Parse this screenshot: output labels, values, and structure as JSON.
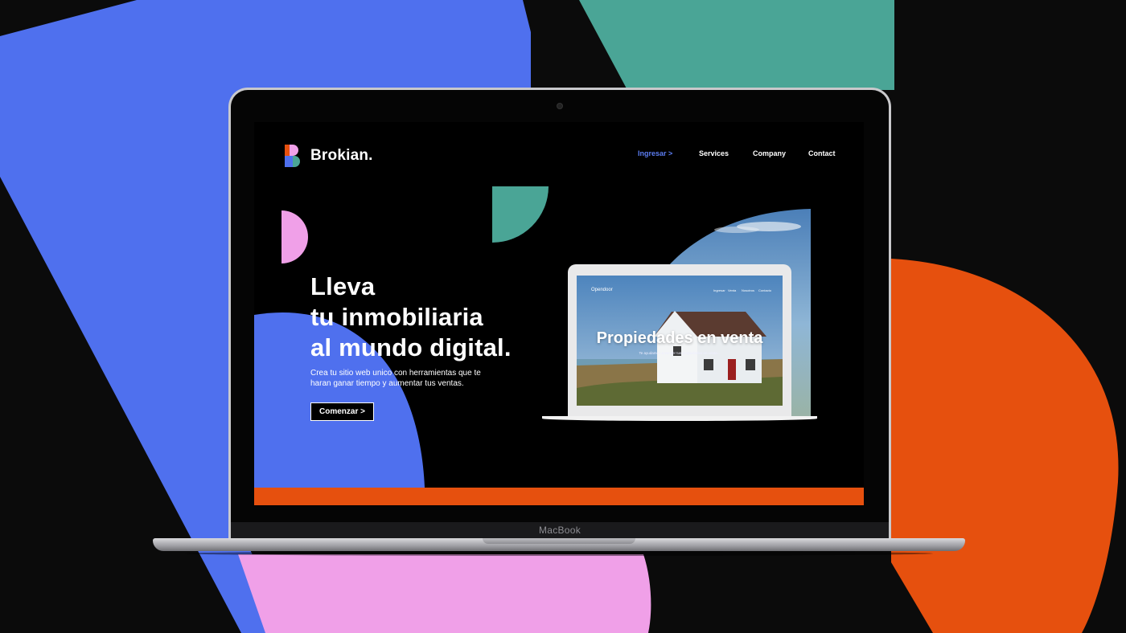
{
  "colors": {
    "blue": "#4f70ee",
    "teal": "#4aa596",
    "orange": "#e6500e",
    "pink": "#f0a0e8",
    "background": "#0b0b0b"
  },
  "device": {
    "label": "MacBook"
  },
  "site": {
    "brand": "Brokian.",
    "nav": [
      {
        "label": "Ingresar  >",
        "active": true
      },
      {
        "label": "Services"
      },
      {
        "label": "Company"
      },
      {
        "label": "Contact"
      }
    ],
    "headline": [
      "Lleva",
      "tu inmobiliaria",
      "al mundo digital."
    ],
    "subtitle": "Crea tu sitio web unico con herramientas que te haran ganar tiempo y aumentar tus ventas.",
    "cta_label": "Comenzar  >"
  },
  "mockup": {
    "brand": "Opendoor",
    "nav": [
      "Ingresar",
      "Venta",
      "Nosotros",
      "Contacto"
    ],
    "title": "Propiedades en venta",
    "subtitle": "Te ayudamos a vender tus propiedades en venta..."
  }
}
